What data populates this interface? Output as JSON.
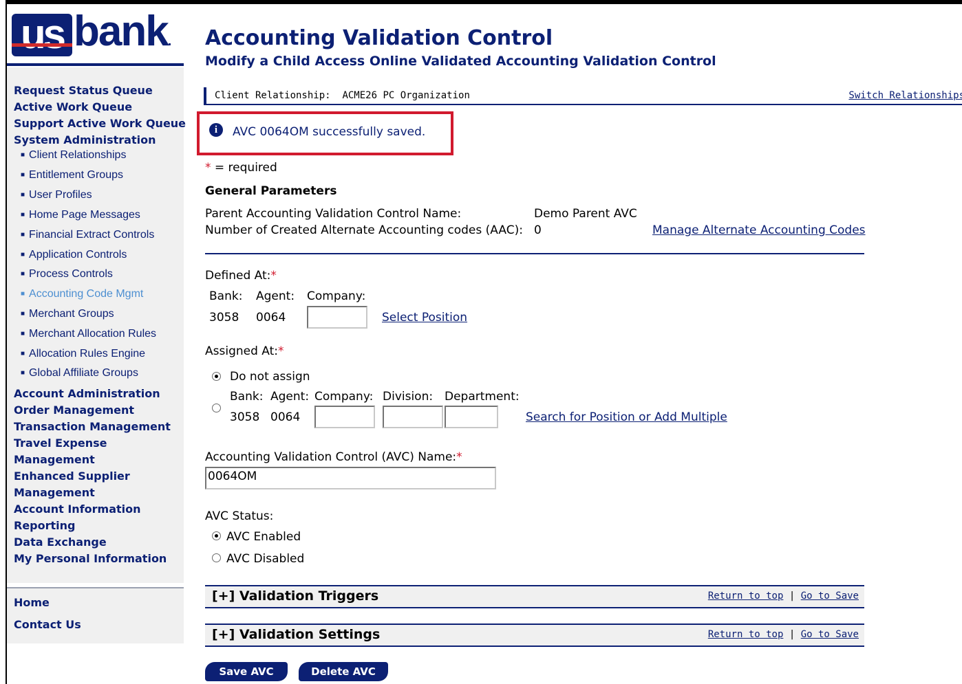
{
  "logo": {
    "us": "us",
    "bank": "bank",
    "dot": "."
  },
  "nav": {
    "items_top": [
      "Request Status Queue",
      "Active Work Queue",
      "Support Active Work Queue",
      "System Administration"
    ],
    "sub_items": [
      "Client Relationships",
      "Entitlement Groups",
      "User Profiles",
      "Home Page Messages",
      "Financial Extract Controls",
      "Application Controls",
      "Process Controls",
      "Accounting Code Mgmt",
      "Merchant Groups",
      "Merchant Allocation Rules",
      "Allocation Rules Engine",
      "Global Affiliate Groups"
    ],
    "active_sub": "Accounting Code Mgmt",
    "items_bottom": [
      "Account Administration",
      "Order Management",
      "Transaction Management",
      "Travel Expense",
      "Management",
      "Enhanced Supplier",
      "Management",
      "Account Information",
      "Reporting",
      "Data Exchange",
      "My Personal Information"
    ],
    "footer": [
      "Home",
      "Contact Us"
    ]
  },
  "header": {
    "title": "Accounting Validation Control",
    "subtitle": "Modify a Child Access Online Validated Accounting Validation Control"
  },
  "relationship": {
    "label": "Client Relationship:",
    "value": "ACME26 PC Organization",
    "switch_link": "Switch Relationships"
  },
  "message": {
    "icon": "info-icon",
    "text": "AVC 0064OM successfully saved."
  },
  "required_note": {
    "star": "*",
    "text": "= required"
  },
  "general": {
    "heading": "General Parameters",
    "parent_label": "Parent Accounting Validation Control Name:",
    "parent_value": "Demo Parent AVC",
    "aac_label": "Number of Created Alternate Accounting codes (AAC):",
    "aac_value": "0",
    "manage_link": "Manage Alternate Accounting Codes"
  },
  "defined_at": {
    "label": "Defined At:",
    "bank_label": "Bank:",
    "agent_label": "Agent:",
    "company_label": "Company:",
    "bank_value": "3058",
    "agent_value": "0064",
    "company_value": "",
    "select_link": "Select Position"
  },
  "assigned_at": {
    "label": "Assigned At:",
    "option_none": "Do not assign",
    "bank_label": "Bank:",
    "agent_label": "Agent:",
    "company_label": "Company:",
    "division_label": "Division:",
    "department_label": "Department:",
    "bank_value": "3058",
    "agent_value": "0064",
    "search_link": "Search for Position or Add Multiple",
    "selected": "Do not assign"
  },
  "avc_name": {
    "label": "Accounting Validation Control (AVC) Name:",
    "value": "0064OM"
  },
  "avc_status": {
    "label": "AVC Status:",
    "enabled": "AVC Enabled",
    "disabled": "AVC Disabled",
    "selected": "AVC Enabled"
  },
  "sections": [
    {
      "title": "[+]  Validation Triggers",
      "return_link": "Return to top",
      "sep": "|",
      "save_link": "Go to Save"
    },
    {
      "title": "[+]  Validation Settings",
      "return_link": "Return to top",
      "sep": "|",
      "save_link": "Go to Save"
    }
  ],
  "buttons": {
    "save": "Save AVC",
    "delete": "Delete AVC"
  },
  "colors": {
    "brand_navy": "#0c2074",
    "alert_red": "#d11a2e",
    "active_link": "#4d8fd1"
  }
}
